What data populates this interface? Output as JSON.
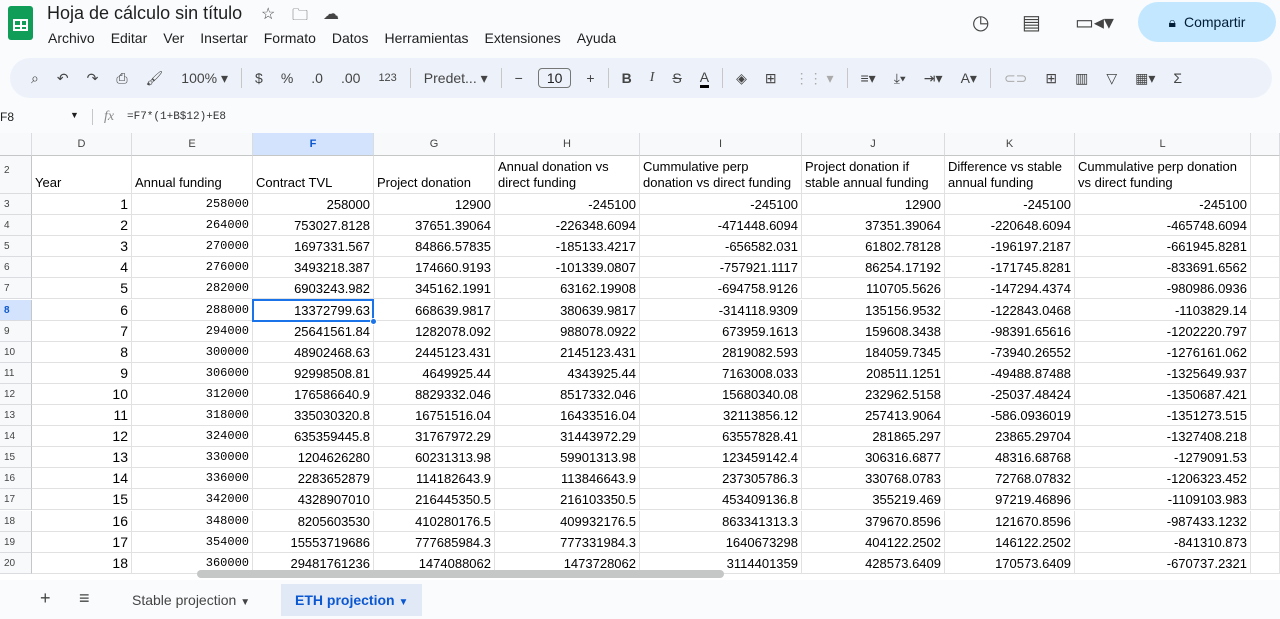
{
  "app": {
    "title": "Hoja de cálculo sin título",
    "share_label": "Compartir",
    "icons": [
      "star-icon",
      "move-folder-icon",
      "cloud-status-icon",
      "history-icon",
      "comments-icon",
      "meet-icon"
    ]
  },
  "menu": [
    "Archivo",
    "Editar",
    "Ver",
    "Insertar",
    "Formato",
    "Datos",
    "Herramientas",
    "Extensiones",
    "Ayuda"
  ],
  "toolbar": {
    "zoom": "100%",
    "currency": "$",
    "percent": "%",
    "dec_decrease": ".0",
    "dec_increase": ".00",
    "number_format": "123",
    "font": "Predet...",
    "font_size": "10"
  },
  "formula_bar": {
    "cell": "F8",
    "fx": "fx",
    "formula": "=F7*(1+B$12)+E8"
  },
  "columns": [
    "D",
    "E",
    "F",
    "G",
    "H",
    "I",
    "J",
    "K",
    "L"
  ],
  "selected_column": "F",
  "selected_row": "8",
  "headers": [
    "Year",
    "Annual funding",
    "Contract TVL",
    "Project donation",
    "Annual donation vs direct funding",
    "Cummulative perp donation vs direct funding",
    "Project donation if stable annual funding",
    "Difference vs stable annual funding",
    "Cummulative perp donation vs direct funding"
  ],
  "row_numbers": [
    "2",
    "3",
    "4",
    "5",
    "6",
    "7",
    "8",
    "9",
    "10",
    "11",
    "12",
    "13",
    "14",
    "15",
    "16",
    "17",
    "18",
    "19",
    "20"
  ],
  "rows": [
    [
      "1",
      "258000",
      "258000",
      "12900",
      "-245100",
      "-245100",
      "12900",
      "-245100",
      "-245100"
    ],
    [
      "2",
      "264000",
      "753027.8128",
      "37651.39064",
      "-226348.6094",
      "-471448.6094",
      "37351.39064",
      "-220648.6094",
      "-465748.6094"
    ],
    [
      "3",
      "270000",
      "1697331.567",
      "84866.57835",
      "-185133.4217",
      "-656582.031",
      "61802.78128",
      "-196197.2187",
      "-661945.8281"
    ],
    [
      "4",
      "276000",
      "3493218.387",
      "174660.9193",
      "-101339.0807",
      "-757921.1117",
      "86254.17192",
      "-171745.8281",
      "-833691.6562"
    ],
    [
      "5",
      "282000",
      "6903243.982",
      "345162.1991",
      "63162.19908",
      "-694758.9126",
      "110705.5626",
      "-147294.4374",
      "-980986.0936"
    ],
    [
      "6",
      "288000",
      "13372799.63",
      "668639.9817",
      "380639.9817",
      "-314118.9309",
      "135156.9532",
      "-122843.0468",
      "-1103829.14"
    ],
    [
      "7",
      "294000",
      "25641561.84",
      "1282078.092",
      "988078.0922",
      "673959.1613",
      "159608.3438",
      "-98391.65616",
      "-1202220.797"
    ],
    [
      "8",
      "300000",
      "48902468.63",
      "2445123.431",
      "2145123.431",
      "2819082.593",
      "184059.7345",
      "-73940.26552",
      "-1276161.062"
    ],
    [
      "9",
      "306000",
      "92998508.81",
      "4649925.44",
      "4343925.44",
      "7163008.033",
      "208511.1251",
      "-49488.87488",
      "-1325649.937"
    ],
    [
      "10",
      "312000",
      "176586640.9",
      "8829332.046",
      "8517332.046",
      "15680340.08",
      "232962.5158",
      "-25037.48424",
      "-1350687.421"
    ],
    [
      "11",
      "318000",
      "335030320.8",
      "16751516.04",
      "16433516.04",
      "32113856.12",
      "257413.9064",
      "-586.0936019",
      "-1351273.515"
    ],
    [
      "12",
      "324000",
      "635359445.8",
      "31767972.29",
      "31443972.29",
      "63557828.41",
      "281865.297",
      "23865.29704",
      "-1327408.218"
    ],
    [
      "13",
      "330000",
      "1204626280",
      "60231313.98",
      "59901313.98",
      "123459142.4",
      "306316.6877",
      "48316.68768",
      "-1279091.53"
    ],
    [
      "14",
      "336000",
      "2283652879",
      "114182643.9",
      "113846643.9",
      "237305786.3",
      "330768.0783",
      "72768.07832",
      "-1206323.452"
    ],
    [
      "15",
      "342000",
      "4328907010",
      "216445350.5",
      "216103350.5",
      "453409136.8",
      "355219.469",
      "97219.46896",
      "-1109103.983"
    ],
    [
      "16",
      "348000",
      "8205603530",
      "410280176.5",
      "409932176.5",
      "863341313.3",
      "379670.8596",
      "121670.8596",
      "-987433.1232"
    ],
    [
      "17",
      "354000",
      "15553719686",
      "777685984.3",
      "777331984.3",
      "1640673298",
      "404122.2502",
      "146122.2502",
      "-841310.873"
    ],
    [
      "18",
      "360000",
      "29481761236",
      "1474088062",
      "1473728062",
      "3114401359",
      "428573.6409",
      "170573.6409",
      "-670737.2321"
    ]
  ],
  "sheets": [
    {
      "label": "Stable projection",
      "active": false
    },
    {
      "label": "ETH projection",
      "active": true
    }
  ],
  "colors": {
    "accent": "#0b57d0",
    "share_bg": "#c2e7ff",
    "toolbar_bg": "#edf2fa",
    "selection": "#1a73e8",
    "logo": "#0f9d58"
  }
}
